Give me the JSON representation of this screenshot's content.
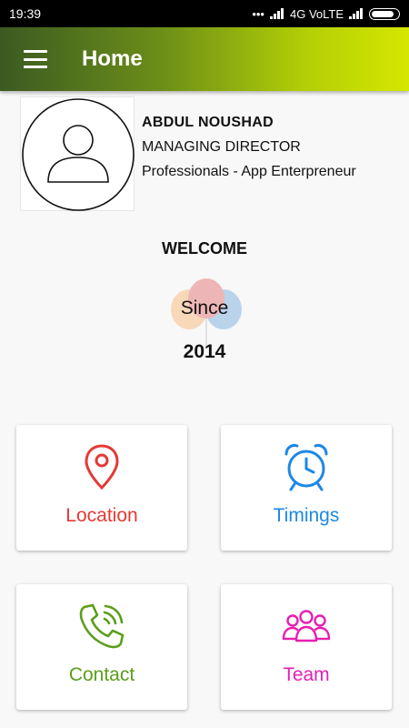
{
  "status_bar": {
    "time": "19:39",
    "network": "4G VoLTE"
  },
  "app_bar": {
    "title": "Home",
    "menu_icon": "hamburger-menu-icon"
  },
  "profile": {
    "avatar_icon": "user-avatar-icon",
    "name": "ABDUL NOUSHAD",
    "role": "MANAGING DIRECTOR",
    "company": "Professionals - App Enterpreneur"
  },
  "welcome": {
    "title": "WELCOME",
    "since_label": "Since",
    "since_year": "2014",
    "background_icon": "balloons-icon"
  },
  "tiles": [
    {
      "label": "Location",
      "icon": "location-pin-icon",
      "color": "#e53935"
    },
    {
      "label": "Timings",
      "icon": "alarm-clock-icon",
      "color": "#1e88e5"
    },
    {
      "label": "Contact",
      "icon": "phone-ringing-icon",
      "color": "#5a9e1a"
    },
    {
      "label": "Team",
      "icon": "team-group-icon",
      "color": "#e91eb0"
    }
  ],
  "colors": {
    "app_bar_gradient_start": "#3b5a22",
    "app_bar_gradient_end": "#d5e600",
    "background": "#f8f8f8"
  }
}
